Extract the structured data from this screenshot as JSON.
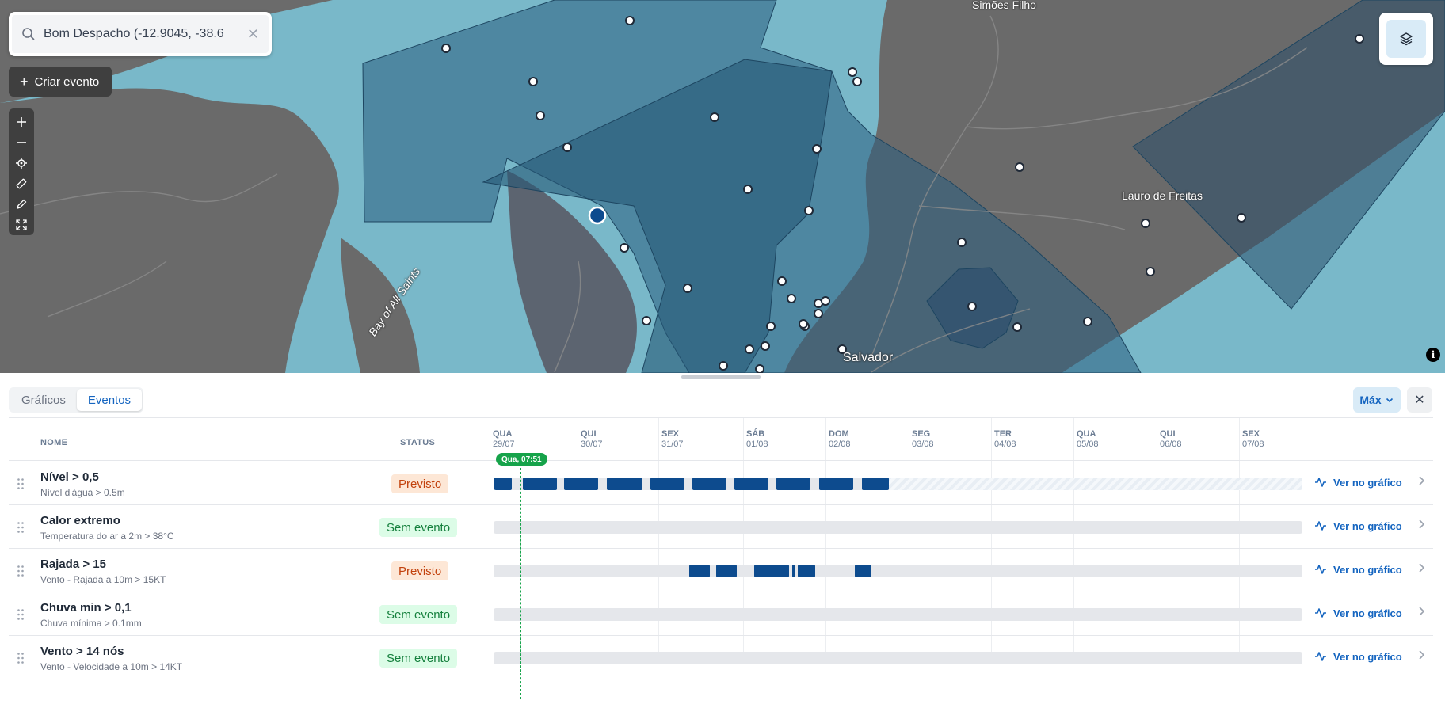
{
  "map": {
    "search": {
      "value": "Bom Despacho (-12.9045, -38.6",
      "placeholder": ""
    },
    "create_event_label": "Criar evento",
    "labels": {
      "simoes_filho": "Simões Filho",
      "lauro_de_freitas": "Lauro de Freitas",
      "salvador": "Salvador",
      "bay": "Bay of All Saints"
    },
    "info_glyph": "i",
    "tools": [
      "zoom-in-icon",
      "zoom-out-icon",
      "locate-icon",
      "ruler-icon",
      "pencil-icon",
      "fullscreen-icon"
    ]
  },
  "panel": {
    "tabs": [
      {
        "label": "Gráficos",
        "active": false
      },
      {
        "label": "Eventos",
        "active": true
      }
    ],
    "max_label": "Máx",
    "close_glyph": "✕",
    "columns": {
      "name": "NOME",
      "status": "STATUS"
    },
    "days": [
      {
        "dow": "QUA",
        "date": "29/07"
      },
      {
        "dow": "QUI",
        "date": "30/07"
      },
      {
        "dow": "SEX",
        "date": "31/07"
      },
      {
        "dow": "SÁB",
        "date": "01/08"
      },
      {
        "dow": "DOM",
        "date": "02/08"
      },
      {
        "dow": "SEG",
        "date": "03/08"
      },
      {
        "dow": "TER",
        "date": "04/08"
      },
      {
        "dow": "QUA",
        "date": "05/08"
      },
      {
        "dow": "QUI",
        "date": "06/08"
      },
      {
        "dow": "SEX",
        "date": "07/08"
      }
    ],
    "now_label": "Qua, 07:51",
    "view_label": "Ver no gráfico",
    "events": [
      {
        "name": "Nível > 0,5",
        "subtitle": "Nível d'água > 0.5m",
        "status": "Previsto",
        "status_kind": "previsto"
      },
      {
        "name": "Calor extremo",
        "subtitle": "Temperatura do ar a 2m > 38°C",
        "status": "Sem evento",
        "status_kind": "sem"
      },
      {
        "name": "Rajada > 15",
        "subtitle": "Vento - Rajada a 10m > 15KT",
        "status": "Previsto",
        "status_kind": "previsto"
      },
      {
        "name": "Chuva min > 0,1",
        "subtitle": "Chuva mínima > 0.1mm",
        "status": "Sem evento",
        "status_kind": "sem"
      },
      {
        "name": "Vento > 14 nós",
        "subtitle": "Vento - Velocidade a 10m > 14KT",
        "status": "Sem evento",
        "status_kind": "sem"
      }
    ]
  },
  "colors": {
    "accent": "#1565c0",
    "event_bar": "#0d4b8e",
    "now_line": "#16a34a",
    "previsto_bg": "#fde7d6",
    "previsto_text": "#c2410c",
    "sem_bg": "#dcfce7",
    "sem_text": "#15803d"
  }
}
